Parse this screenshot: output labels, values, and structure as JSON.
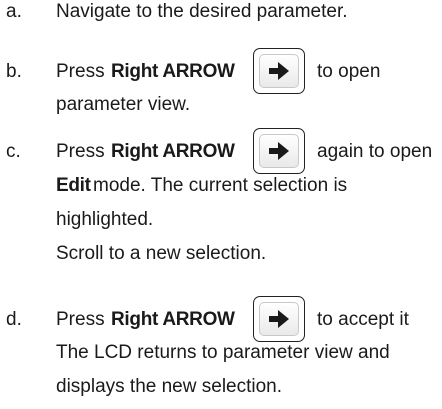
{
  "steps": {
    "a": {
      "marker": "a.",
      "text": "Navigate to the desired parameter."
    },
    "b": {
      "marker": "b.",
      "pre": "Press",
      "key": "Right ARROW",
      "post": "to open",
      "line2": "parameter view."
    },
    "c": {
      "marker": "c.",
      "pre": "Press",
      "key": "Right ARROW",
      "post": "again to open",
      "line2_bold": "Edit",
      "line2_rest": "mode. The current selection is",
      "line3": "highlighted.",
      "line4": "Scroll to a new selection."
    },
    "d": {
      "marker": "d.",
      "pre": "Press",
      "key": "Right ARROW",
      "post": "to accept it",
      "line2": "The LCD returns to parameter view and",
      "line3": "displays the new selection."
    }
  },
  "icons": {
    "key_icon": "right-arrow-key",
    "arrow_color": "#1a1a1a"
  }
}
